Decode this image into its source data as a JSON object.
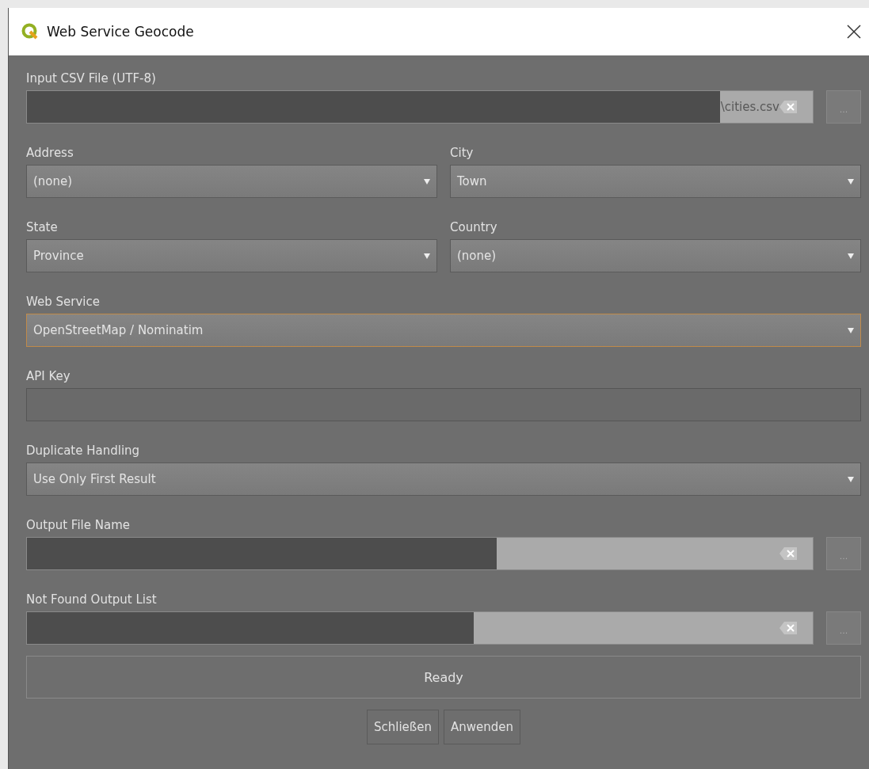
{
  "window": {
    "title": "Web Service Geocode"
  },
  "rows": [
    {
      "fields": [
        {
          "kind": "file",
          "label": "Input CSV File (UTF-8)",
          "value": "\\cities.csv",
          "redacted": true,
          "browse": "..."
        }
      ]
    },
    {
      "fields": [
        {
          "kind": "combo",
          "label": "Address",
          "value": "(none)",
          "focused": false
        },
        {
          "kind": "combo",
          "label": "City",
          "value": "Town",
          "focused": false
        }
      ]
    },
    {
      "fields": [
        {
          "kind": "combo",
          "label": "State",
          "value": "Province",
          "focused": false
        },
        {
          "kind": "combo",
          "label": "Country",
          "value": "(none)",
          "focused": false
        }
      ]
    },
    {
      "fields": [
        {
          "kind": "combo",
          "label": "Web Service",
          "value": "OpenStreetMap / Nominatim",
          "focused": true
        }
      ]
    },
    {
      "fields": [
        {
          "kind": "text",
          "label": "API Key"
        }
      ]
    },
    {
      "fields": [
        {
          "kind": "combo",
          "label": "Duplicate Handling",
          "value": "Use Only First Result",
          "focused": false
        }
      ]
    },
    {
      "fields": [
        {
          "kind": "file",
          "label": "Output File Name",
          "redacted": true,
          "browse": "..."
        }
      ]
    },
    {
      "fields": [
        {
          "kind": "file",
          "label": "Not Found Output List",
          "redacted": true,
          "browse": "..."
        }
      ]
    }
  ],
  "status": "Ready",
  "buttons": [
    "Schließen",
    "Anwenden"
  ]
}
